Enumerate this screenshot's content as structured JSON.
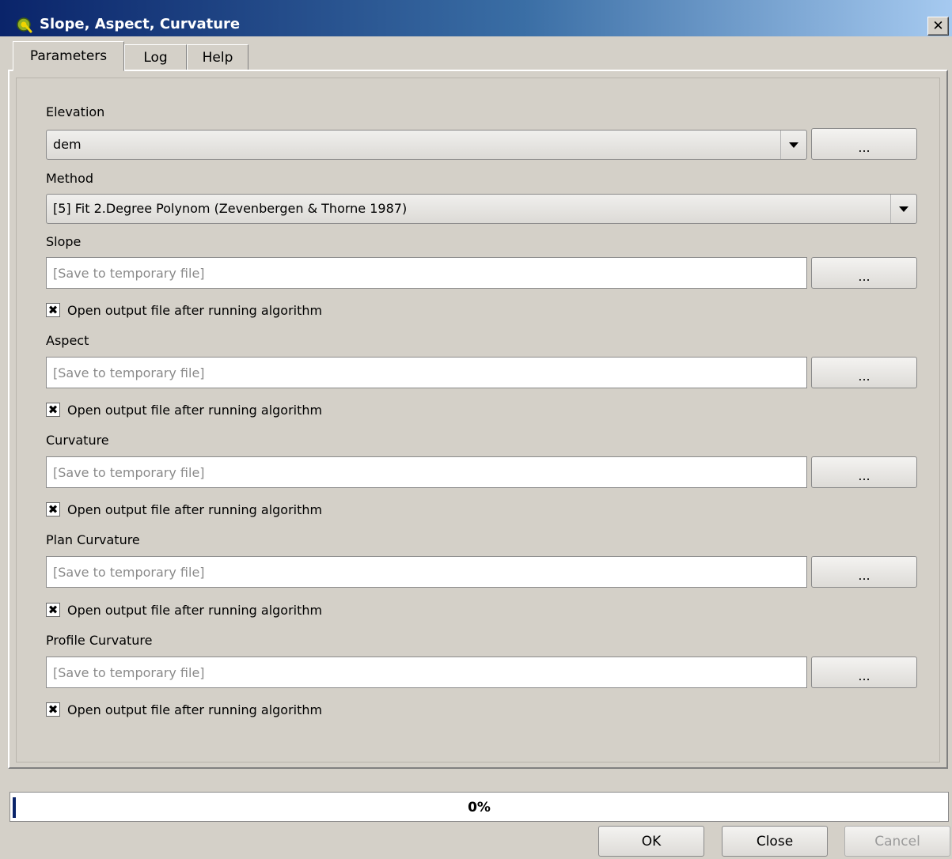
{
  "window": {
    "title": "Slope, Aspect, Curvature",
    "close_glyph": "✕"
  },
  "tabs": [
    {
      "label": "Parameters",
      "active": true
    },
    {
      "label": "Log",
      "active": false
    },
    {
      "label": "Help",
      "active": false
    }
  ],
  "params": {
    "elevation": {
      "label": "Elevation",
      "value": "dem",
      "browse_label": "..."
    },
    "method": {
      "label": "Method",
      "value": "[5] Fit 2.Degree Polynom (Zevenbergen & Thorne 1987)"
    },
    "outputs": [
      {
        "label": "Slope",
        "placeholder": "[Save to temporary file]",
        "browse_label": "...",
        "open_label": "Open output file after running algorithm",
        "checked": true
      },
      {
        "label": "Aspect",
        "placeholder": "[Save to temporary file]",
        "browse_label": "...",
        "open_label": "Open output file after running algorithm",
        "checked": true
      },
      {
        "label": "Curvature",
        "placeholder": "[Save to temporary file]",
        "browse_label": "...",
        "open_label": "Open output file after running algorithm",
        "checked": true
      },
      {
        "label": "Plan Curvature",
        "placeholder": "[Save to temporary file]",
        "browse_label": "...",
        "open_label": "Open output file after running algorithm",
        "checked": true
      },
      {
        "label": "Profile Curvature",
        "placeholder": "[Save to temporary file]",
        "browse_label": "...",
        "open_label": "Open output file after running algorithm",
        "checked": true
      }
    ]
  },
  "progress": {
    "text": "0%",
    "value": 0
  },
  "buttons": {
    "ok": "OK",
    "close": "Close",
    "cancel": "Cancel"
  },
  "colors": {
    "title_start": "#0a246a",
    "title_end": "#a6caf0",
    "window_bg": "#d4d0c8",
    "progress_fill": "#0a246a"
  },
  "icons": {
    "app": "qgis-icon",
    "checkbox_mark": "✖"
  }
}
